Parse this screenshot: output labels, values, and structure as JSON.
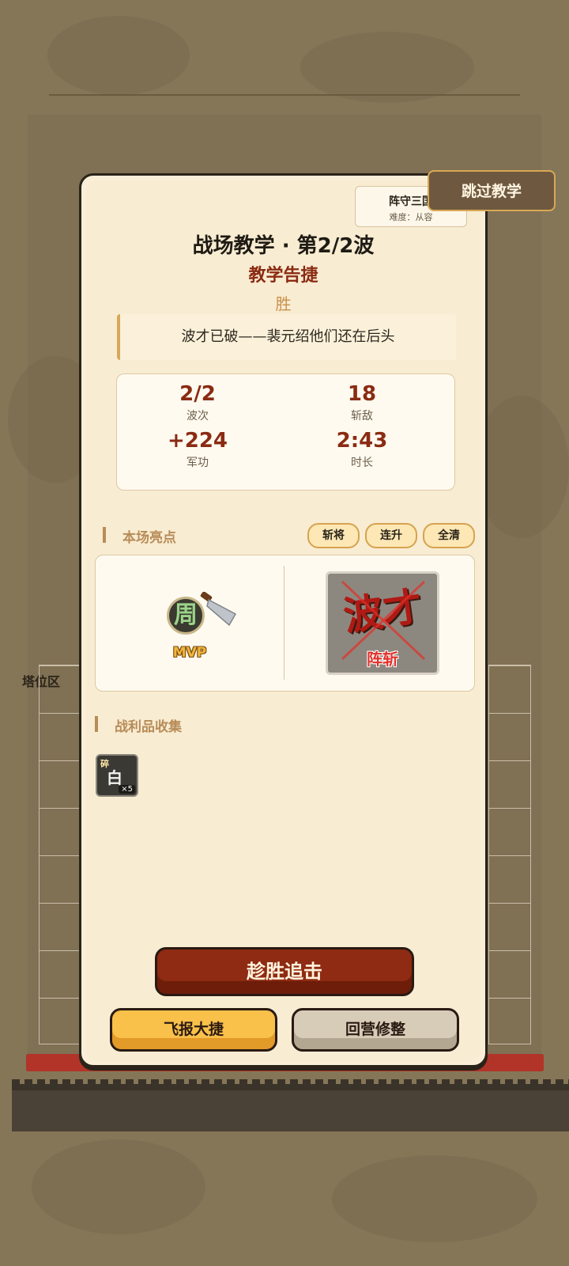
{
  "background": {
    "side_label": "塔位区"
  },
  "header": {
    "game_name": "阵守三国",
    "difficulty": "难度：从容",
    "skip_label": "跳过教学"
  },
  "result_panel": {
    "title": "战场教学 · 第2/2波",
    "subtitle": "教学告捷",
    "result": "胜",
    "quote": "波才已破——裴元绍他们还在后头"
  },
  "stats": [
    {
      "value": "2/2",
      "label": "波次"
    },
    {
      "value": "18",
      "label": "斩敌"
    },
    {
      "value": "+224",
      "label": "军功"
    },
    {
      "value": "2:43",
      "label": "时长"
    }
  ],
  "highlights": {
    "section_title": "本场亮点",
    "chips": [
      "斩将",
      "连升",
      "全清"
    ],
    "mvp_hero_glyph": "周",
    "mvp_label": "MVP",
    "killed_general": "波才",
    "kill_tag": "阵斩"
  },
  "loot": {
    "section_title": "战利品收集",
    "items": [
      {
        "kind": "碎",
        "name": "白",
        "count": "×5"
      }
    ]
  },
  "actions": {
    "primary": "趁胜追击",
    "share": "飞报大捷",
    "back": "回营修整"
  },
  "colors": {
    "accent_red": "#8a2b12",
    "accent_gold": "#f9c04a",
    "panel_bg": "#f8ecd2"
  }
}
